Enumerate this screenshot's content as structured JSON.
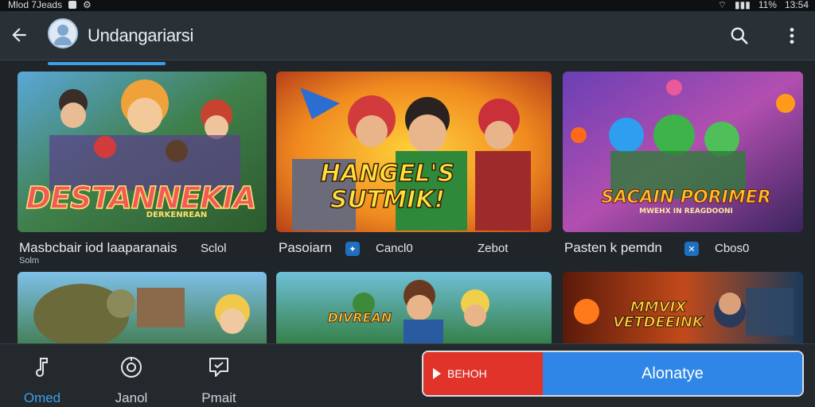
{
  "status": {
    "left_text": "Mlod 7Jeads",
    "right_text": "11%",
    "time": "13:54"
  },
  "appbar": {
    "title": "Undangariarsi",
    "back_icon": "arrow-left-icon",
    "search_icon": "search-icon",
    "more_icon": "more-vertical-icon"
  },
  "cards": [
    {
      "logo_main": "DESTANNEKIA",
      "logo_sub": "DERKENREAN",
      "caption": "Masbcbair iod laaparanais",
      "caption_extra": "Sclol",
      "caption_small": "Solm"
    },
    {
      "logo_main": "HANGEL'S SUTMIK!",
      "logo_sub": "",
      "caption": "Pasoiarn",
      "caption_extra": "Cancl0",
      "caption_extra2": "Zebot"
    },
    {
      "logo_main": "SACAIN PORIMER",
      "logo_sub": "MWEHX IN REAGDOONI",
      "caption": "Pasten k pemdn",
      "caption_extra": "Cbos0"
    },
    {
      "logo_main": "",
      "logo_sub": ""
    },
    {
      "logo_main": "DIVREAN",
      "logo_sub": ""
    },
    {
      "logo_main": "MMVIX VETDEEINK",
      "logo_sub": ""
    }
  ],
  "bottom_nav": [
    {
      "label": "Omed",
      "icon": "music-note-icon",
      "active": true
    },
    {
      "label": "Janol",
      "icon": "play-circle-icon",
      "active": false
    },
    {
      "label": "Pmait",
      "icon": "chat-bubble-icon",
      "active": false
    }
  ],
  "action": {
    "left_label": "BEHOH",
    "right_label": "Alonatye"
  },
  "colors": {
    "accent": "#3ca0e6",
    "red": "#e0342a",
    "blue": "#2f86e6"
  }
}
